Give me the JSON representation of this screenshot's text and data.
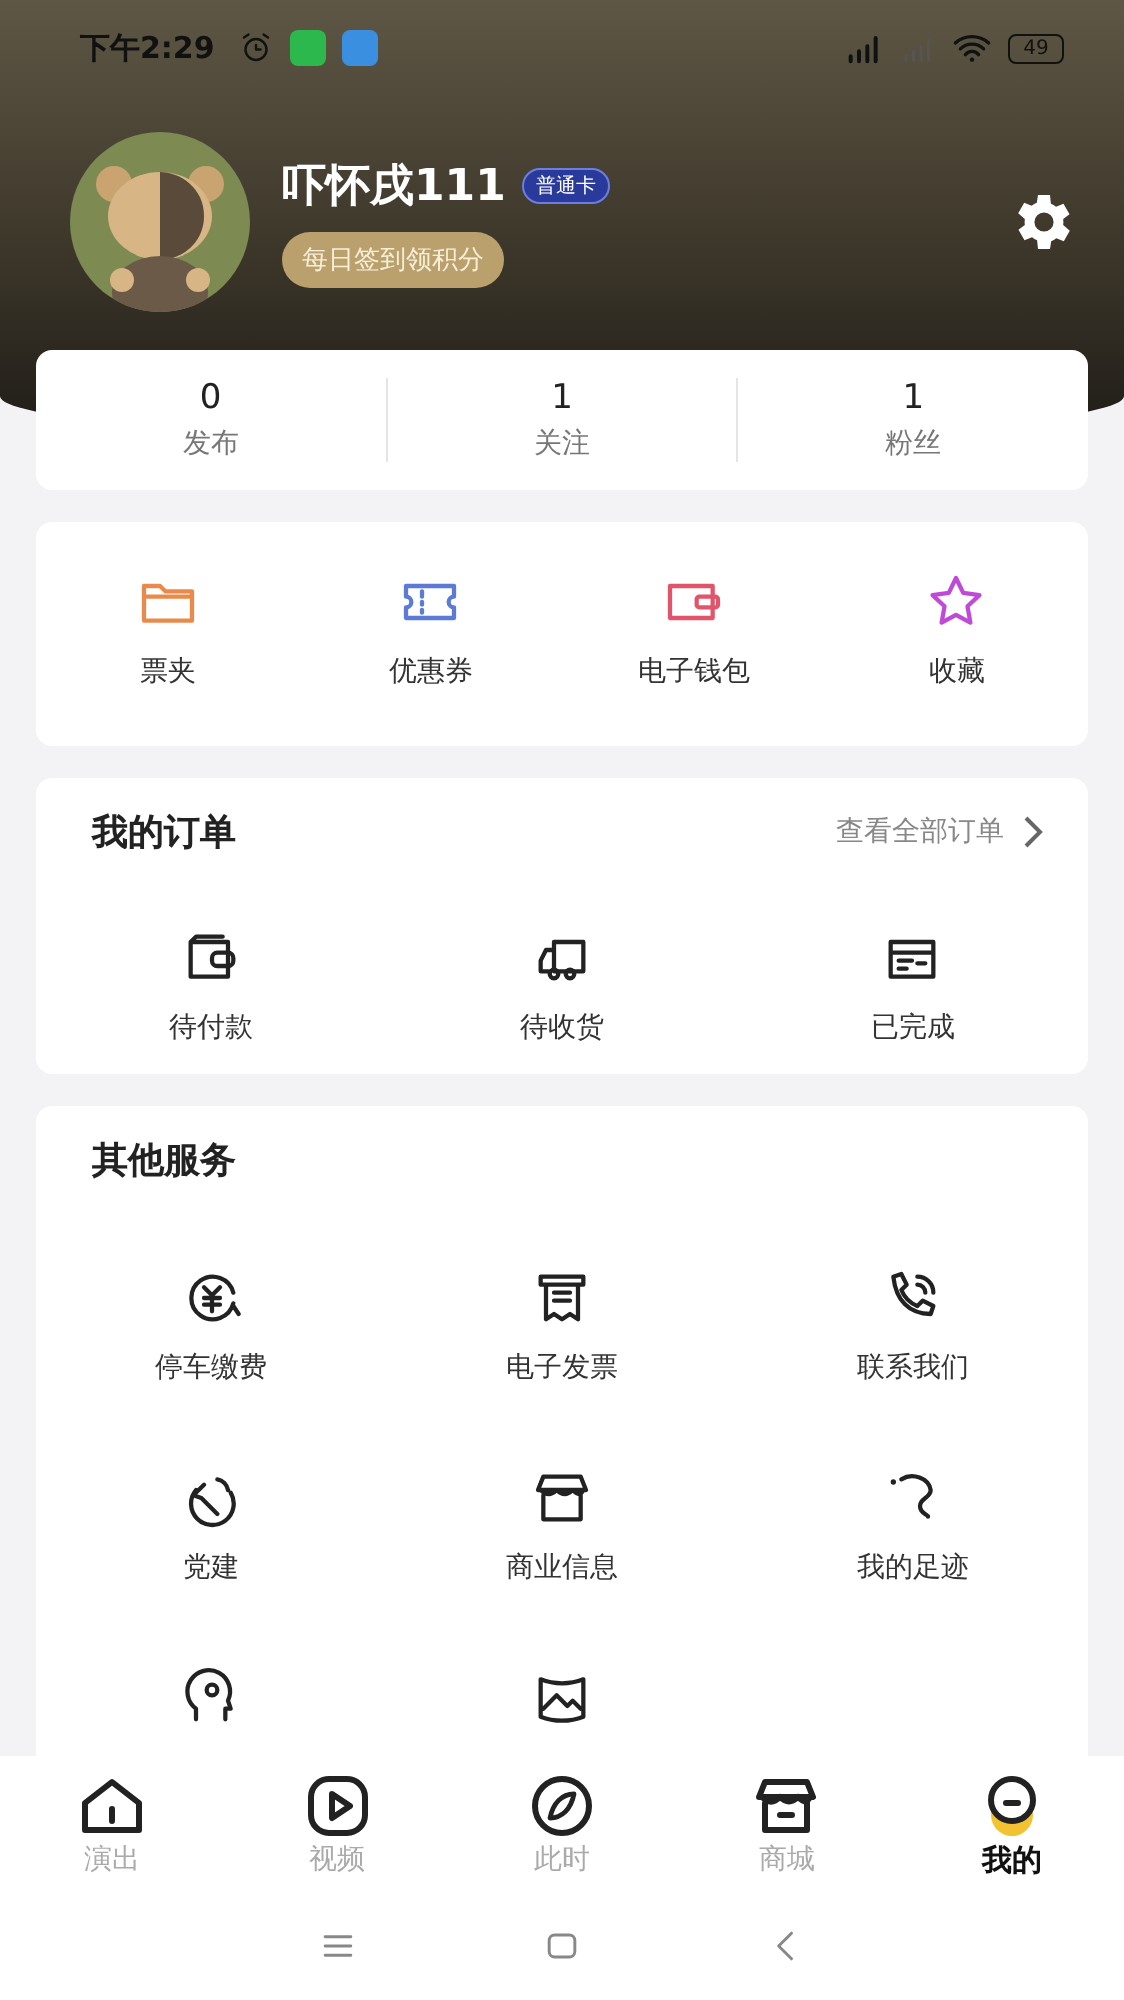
{
  "status_bar": {
    "time": "下午2:29",
    "battery": "49"
  },
  "profile": {
    "name": "吓怀戌111",
    "badge": "普通卡",
    "checkin": "每日签到领积分"
  },
  "stats": [
    {
      "value": "0",
      "label": "发布"
    },
    {
      "value": "1",
      "label": "关注"
    },
    {
      "value": "1",
      "label": "粉丝"
    }
  ],
  "shortcuts": [
    {
      "label": "票夹"
    },
    {
      "label": "优惠券"
    },
    {
      "label": "电子钱包"
    },
    {
      "label": "收藏"
    }
  ],
  "orders": {
    "title": "我的订单",
    "link": "查看全部订单",
    "items": [
      {
        "label": "待付款"
      },
      {
        "label": "待收货"
      },
      {
        "label": "已完成"
      }
    ]
  },
  "services": {
    "title": "其他服务",
    "items": [
      {
        "kind": "full",
        "label": "停车缴费"
      },
      {
        "kind": "full",
        "label": "电子发票"
      },
      {
        "kind": "full",
        "label": "联系我们"
      },
      {
        "kind": "full",
        "label": "党建"
      },
      {
        "kind": "full",
        "label": "商业信息"
      },
      {
        "kind": "full",
        "label": "我的足迹"
      },
      {
        "kind": "cut"
      },
      {
        "kind": "cut"
      }
    ]
  },
  "tabs": [
    {
      "label": "演出",
      "selected": false
    },
    {
      "label": "视频",
      "selected": false
    },
    {
      "label": "此时",
      "selected": false
    },
    {
      "label": "商城",
      "selected": false
    },
    {
      "label": "我的",
      "selected": true
    }
  ]
}
